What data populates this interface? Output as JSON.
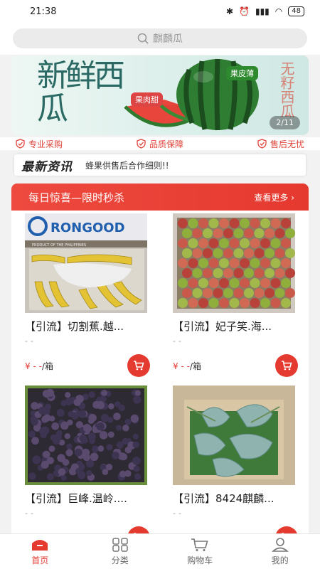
{
  "status": {
    "time": "21:38",
    "battery": "48"
  },
  "search": {
    "placeholder": "麒麟瓜"
  },
  "banner": {
    "title": "新鲜西瓜",
    "side_text": "无籽西瓜",
    "tag_left": "果肉甜",
    "tag_right": "果皮薄",
    "page_indicator": "2/11"
  },
  "guarantees": [
    {
      "label": "专业采购"
    },
    {
      "label": "品质保障"
    },
    {
      "label": "售后无忧"
    }
  ],
  "news": {
    "logo": "最新资讯",
    "text": "蜂果供售后合作细则!!"
  },
  "flash_sale": {
    "title": "每日惊喜—限时秒杀",
    "more": "查看更多"
  },
  "products": [
    {
      "name": "【引流】切割蕉.越...",
      "sub": "--",
      "price": "¥ - -",
      "unit": "/箱",
      "image_brand": "RONGOOD",
      "image_origin": "PRODUCT OF THE PHILIPPINES"
    },
    {
      "name": "【引流】妃子笑.海...",
      "sub": "--",
      "price": "¥ - -",
      "unit": "/箱"
    },
    {
      "name": "【引流】巨峰.温岭....",
      "sub": "--",
      "price": "",
      "unit": ""
    },
    {
      "name": "【引流】8424麒麟...",
      "sub": "--",
      "price": "",
      "unit": ""
    }
  ],
  "tabs": [
    {
      "label": "首页"
    },
    {
      "label": "分类"
    },
    {
      "label": "购物车"
    },
    {
      "label": "我的"
    }
  ],
  "colors": {
    "accent": "#e53a30",
    "banner_green": "#2b6a64"
  }
}
